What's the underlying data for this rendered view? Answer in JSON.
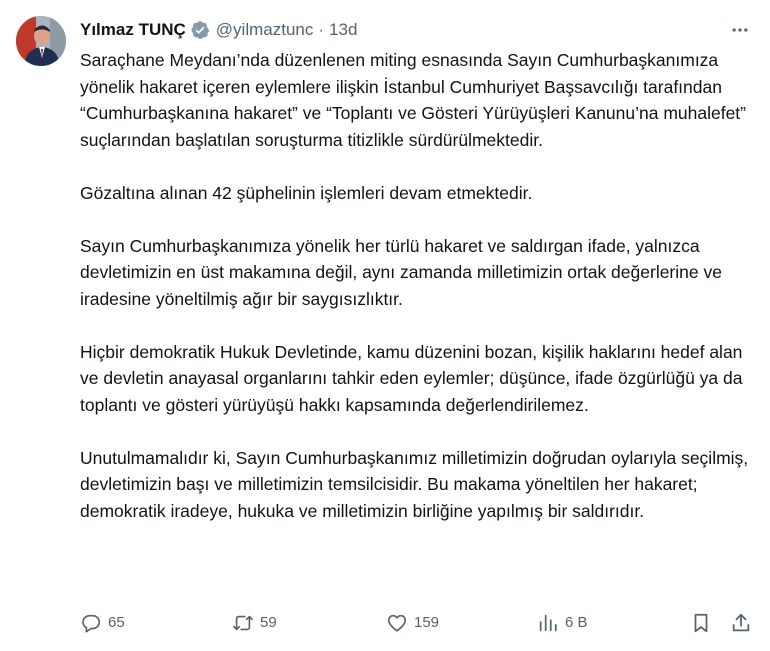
{
  "author": {
    "name": "Yılmaz TUNÇ",
    "handle": "@yilmaztunc",
    "separator": "·",
    "time": "13d"
  },
  "tweet": {
    "paragraphs": [
      "Saraçhane Meydanı’nda düzenlenen miting esnasında Sayın Cumhurbaşkanımıza yönelik hakaret içeren eylemlere ilişkin İstanbul Cumhuriyet Başsavcılığı tarafından “Cumhurbaşkanına hakaret” ve “Toplantı ve Gösteri Yürüyüşleri Kanunu’na muhalefet” suçlarından başlatılan soruşturma titizlikle sürdürülmektedir.",
      "Gözaltına alınan 42 şüphelinin işlemleri devam etmektedir.",
      "Sayın Cumhurbaşkanımıza yönelik her türlü hakaret ve saldırgan ifade, yalnızca devletimizin en üst makamına değil, aynı zamanda milletimizin ortak değerlerine ve iradesine yöneltilmiş ağır bir saygısızlıktır.",
      "Hiçbir demokratik Hukuk Devletinde, kamu düzenini bozan, kişilik haklarını hedef alan ve devletin anayasal organlarını tahkir eden eylemler; düşünce, ifade özgürlüğü ya da toplantı ve gösteri yürüyüşü hakkı kapsamında değerlendirilemez.",
      "Unutulmamalıdır ki, Sayın Cumhurbaşkanımız milletimizin doğrudan oylarıyla seçilmiş, devletimizin başı ve milletimizin temsilcisidir.  Bu makama yöneltilen her hakaret; demokratik iradeye, hukuka ve milletimizin birliğine yapılmış bir saldırıdır."
    ]
  },
  "actions": {
    "replies": "65",
    "reposts": "59",
    "likes": "159",
    "views": "6 B"
  },
  "icons": {
    "verified": "verified-badge-icon",
    "more": "more-icon",
    "reply": "reply-icon",
    "repost": "repost-icon",
    "like": "heart-icon",
    "views": "views-icon",
    "bookmark": "bookmark-icon",
    "share": "share-icon"
  },
  "colors": {
    "text": "#0f1419",
    "secondary": "#536471",
    "verified_fill": "#829aab"
  }
}
